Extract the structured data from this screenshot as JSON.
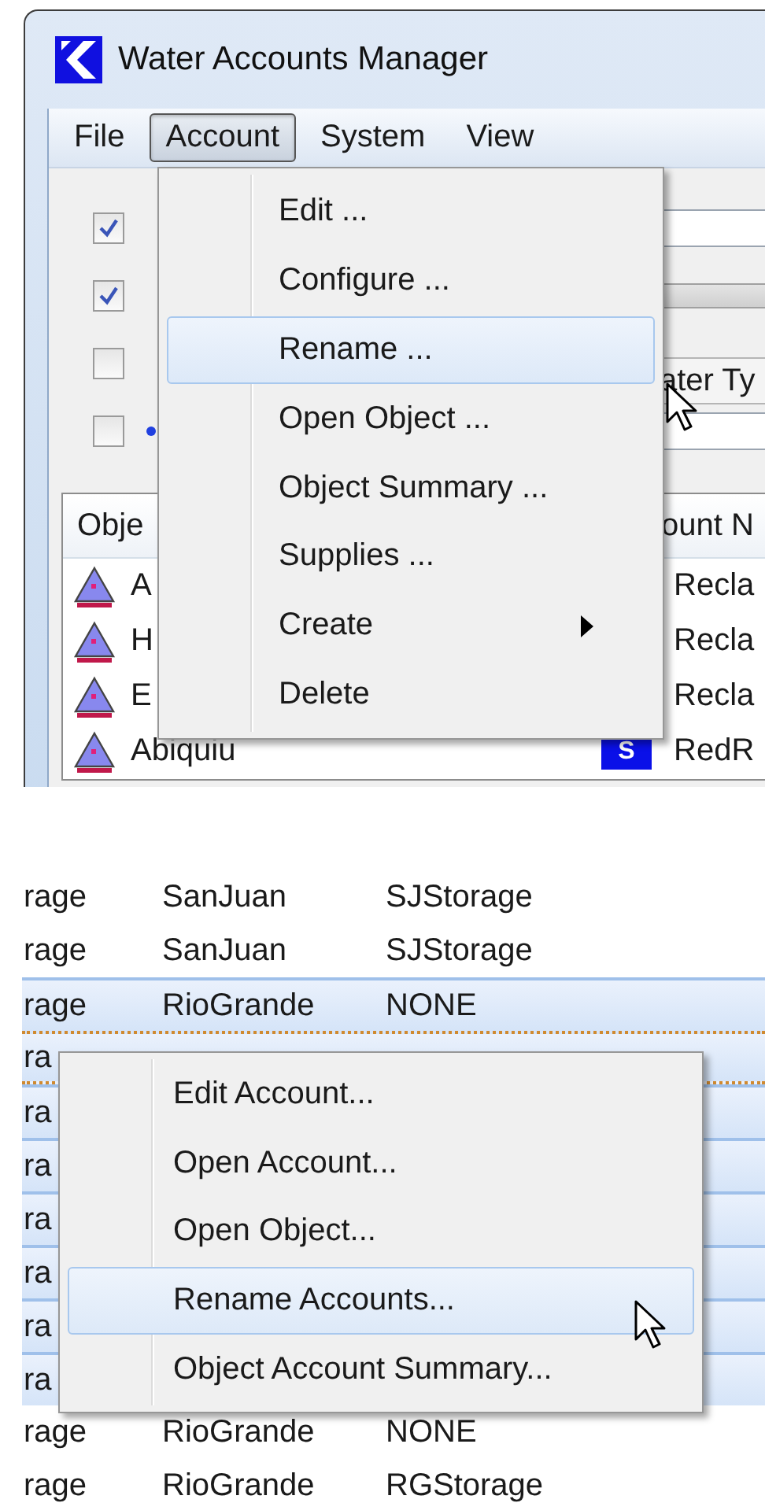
{
  "top_window": {
    "title": "Water Accounts Manager",
    "menu_bar": [
      {
        "label": "File",
        "selected": false
      },
      {
        "label": "Account",
        "selected": true
      },
      {
        "label": "System",
        "selected": false
      },
      {
        "label": "View",
        "selected": false
      }
    ],
    "filters": [
      {
        "checked": true,
        "kind": "field"
      },
      {
        "checked": true,
        "kind": "bar"
      },
      {
        "checked": false,
        "kind": "label",
        "label": "ater Ty"
      },
      {
        "checked": false,
        "kind": "dot"
      }
    ],
    "list": {
      "columns": [
        "Obje",
        "ount N"
      ],
      "rows": [
        {
          "name": "A",
          "value": "Recla"
        },
        {
          "name": "H",
          "value": "Recla"
        },
        {
          "name": "E",
          "value": "Recla"
        },
        {
          "name": "Abiquiu",
          "badge": "S",
          "value": "RedR"
        }
      ]
    },
    "menu": {
      "items": [
        {
          "label": "Edit ...",
          "kind": "item",
          "selected": false
        },
        {
          "label": "Configure ...",
          "kind": "item",
          "selected": false
        },
        {
          "label": "Rename ...",
          "kind": "item",
          "selected": true
        },
        {
          "label": "Open Object ...",
          "kind": "item",
          "selected": false
        },
        {
          "label": "Object Summary ...",
          "kind": "item",
          "selected": false
        },
        {
          "label": "Supplies ...",
          "kind": "item",
          "selected": false
        },
        {
          "label": "Create",
          "kind": "submenu",
          "selected": false
        },
        {
          "label": "Delete",
          "kind": "item",
          "selected": false
        }
      ]
    }
  },
  "bottom_table": {
    "rows": [
      {
        "cells": [
          "rage",
          "SanJuan",
          "SJStorage"
        ],
        "selected": false,
        "focused": false
      },
      {
        "cells": [
          "rage",
          "SanJuan",
          "SJStorage"
        ],
        "selected": false,
        "focused": false
      },
      {
        "cells": [
          "rage",
          "RioGrande",
          "NONE"
        ],
        "selected": true,
        "focused": false
      },
      {
        "cells": [
          "ra"
        ],
        "selected": true,
        "focused": true
      },
      {
        "cells": [
          "ra"
        ],
        "selected": true,
        "focused": false
      },
      {
        "cells": [
          "ra"
        ],
        "selected": true,
        "focused": false
      },
      {
        "cells": [
          "ra"
        ],
        "selected": true,
        "focused": false
      },
      {
        "cells": [
          "ra"
        ],
        "selected": true,
        "focused": false
      },
      {
        "cells": [
          "ra"
        ],
        "selected": true,
        "focused": false
      },
      {
        "cells": [
          "ra"
        ],
        "selected": true,
        "focused": false
      },
      {
        "cells": [
          "rage",
          "RioGrande",
          "NONE"
        ],
        "selected": false,
        "focused": false
      },
      {
        "cells": [
          "rage",
          "RioGrande",
          "RGStorage"
        ],
        "selected": false,
        "focused": false
      }
    ],
    "context_menu": {
      "items": [
        {
          "label": "Edit Account...",
          "selected": false
        },
        {
          "label": "Open Account...",
          "selected": false
        },
        {
          "label": "Open Object...",
          "selected": false
        },
        {
          "label": "Rename Accounts...",
          "selected": true
        },
        {
          "label": "Object Account Summary...",
          "selected": false
        }
      ]
    }
  }
}
